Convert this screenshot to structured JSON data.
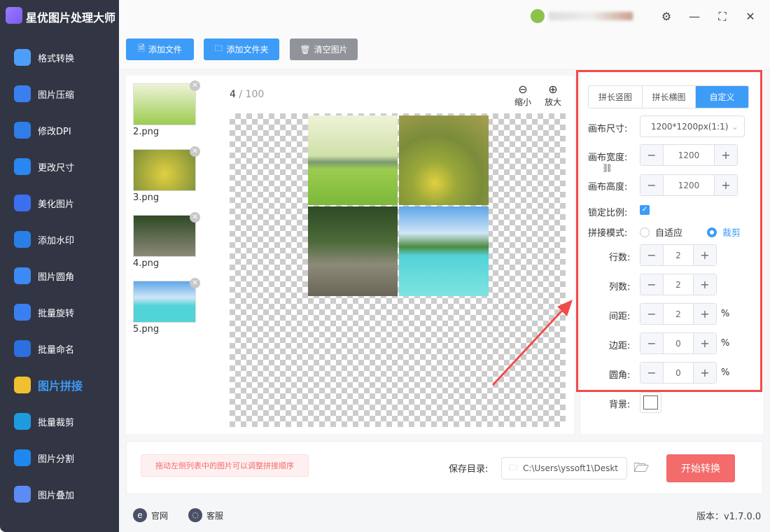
{
  "app": {
    "title": "星优图片处理大师",
    "version": "版本：v1.7.0.0"
  },
  "sidebar": {
    "items": [
      {
        "label": "格式转换",
        "color": "#4d9ef8"
      },
      {
        "label": "图片压缩",
        "color": "#3a7ff0"
      },
      {
        "label": "修改DPI",
        "color": "#2f7de8"
      },
      {
        "label": "更改尺寸",
        "color": "#2a86f2"
      },
      {
        "label": "美化图片",
        "color": "#3a6ff0"
      },
      {
        "label": "添加水印",
        "color": "#2a7ee8"
      },
      {
        "label": "图片圆角",
        "color": "#3b8af5"
      },
      {
        "label": "批量旋转",
        "color": "#3a7ff0"
      },
      {
        "label": "批量命名",
        "color": "#2c6fe0"
      },
      {
        "label": "图片拼接",
        "color": "#f0c030",
        "active": true
      },
      {
        "label": "批量裁剪",
        "color": "#1e9be0"
      },
      {
        "label": "图片分割",
        "color": "#1e88f0"
      },
      {
        "label": "图片叠加",
        "color": "#5b8cf5"
      }
    ]
  },
  "toolbar": {
    "add_file": "添加文件",
    "add_folder": "添加文件夹",
    "clear": "清空图片"
  },
  "window": {
    "settings": "⚙",
    "minimize": "—",
    "maximize": "⛶",
    "close": "✕"
  },
  "preview": {
    "page": "4",
    "total": "/ 100",
    "zoom_out": "缩小",
    "zoom_in": "放大"
  },
  "thumbs": [
    {
      "name": "2.png"
    },
    {
      "name": "3.png"
    },
    {
      "name": "4.png"
    },
    {
      "name": "5.png"
    }
  ],
  "panel": {
    "tabs": [
      "拼长竖图",
      "拼长横图",
      "自定义"
    ],
    "active_tab": 2,
    "canvas_size_label": "画布尺寸:",
    "canvas_size": "1200*1200px(1:1)",
    "width_label": "画布宽度:",
    "width": "1200",
    "height_label": "画布高度:",
    "height": "1200",
    "lock_label": "锁定比例:",
    "lock": true,
    "mode_label": "拼接模式:",
    "mode_fit": "自适应",
    "mode_crop": "裁剪",
    "rows_label": "行数:",
    "rows": "2",
    "cols_label": "列数:",
    "cols": "2",
    "gap_label": "间距:",
    "gap": "2",
    "margin_label": "边距:",
    "margin": "0",
    "radius_label": "圆角:",
    "radius": "0",
    "percent": "%",
    "bg_label": "背景:"
  },
  "bottom": {
    "hint": "拖动左侧列表中的图片可以调整拼接顺序",
    "save_label": "保存目录:",
    "save_path": "C:\\Users\\yssoft1\\Deskt",
    "start": "开始转换"
  },
  "footer": {
    "website": "官网",
    "support": "客服"
  },
  "colors": {
    "accent": "#3d9cf7",
    "sidebar": "#323644",
    "start": "#f36b6b",
    "highlight": "#f04b4b"
  }
}
